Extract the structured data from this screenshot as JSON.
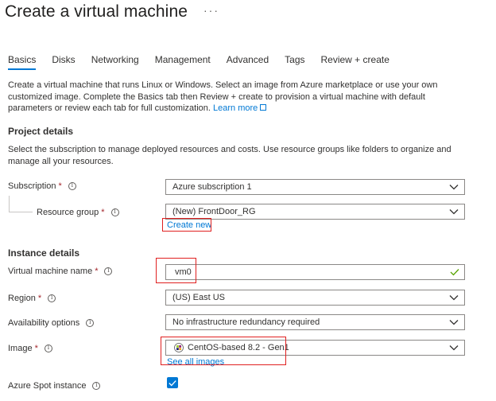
{
  "header": {
    "title": "Create a virtual machine",
    "more": "···"
  },
  "tabs": [
    "Basics",
    "Disks",
    "Networking",
    "Management",
    "Advanced",
    "Tags",
    "Review + create"
  ],
  "intro": {
    "text": "Create a virtual machine that runs Linux or Windows. Select an image from Azure marketplace or use your own customized image. Complete the Basics tab then Review + create to provision a virtual machine with default parameters or review each tab for full customization.",
    "learn_more": "Learn more"
  },
  "project": {
    "heading": "Project details",
    "desc": "Select the subscription to manage deployed resources and costs. Use resource groups like folders to organize and manage all your resources.",
    "subscription_label": "Subscription",
    "subscription_value": "Azure subscription 1",
    "rg_label": "Resource group",
    "rg_value": "(New) FrontDoor_RG",
    "create_new": "Create new"
  },
  "instance": {
    "heading": "Instance details",
    "vmname_label": "Virtual machine name",
    "vmname_value": "vm0",
    "region_label": "Region",
    "region_value": "(US) East US",
    "avail_label": "Availability options",
    "avail_value": "No infrastructure redundancy required",
    "image_label": "Image",
    "image_value": "CentOS-based 8.2 - Gen1",
    "see_all_images": "See all images",
    "spot_label": "Azure Spot instance",
    "spot_checked": true
  },
  "req_mark": "*",
  "colors": {
    "accent": "#0078d4",
    "highlight": "#e02020",
    "required": "#a4262c",
    "valid": "#57a300"
  }
}
